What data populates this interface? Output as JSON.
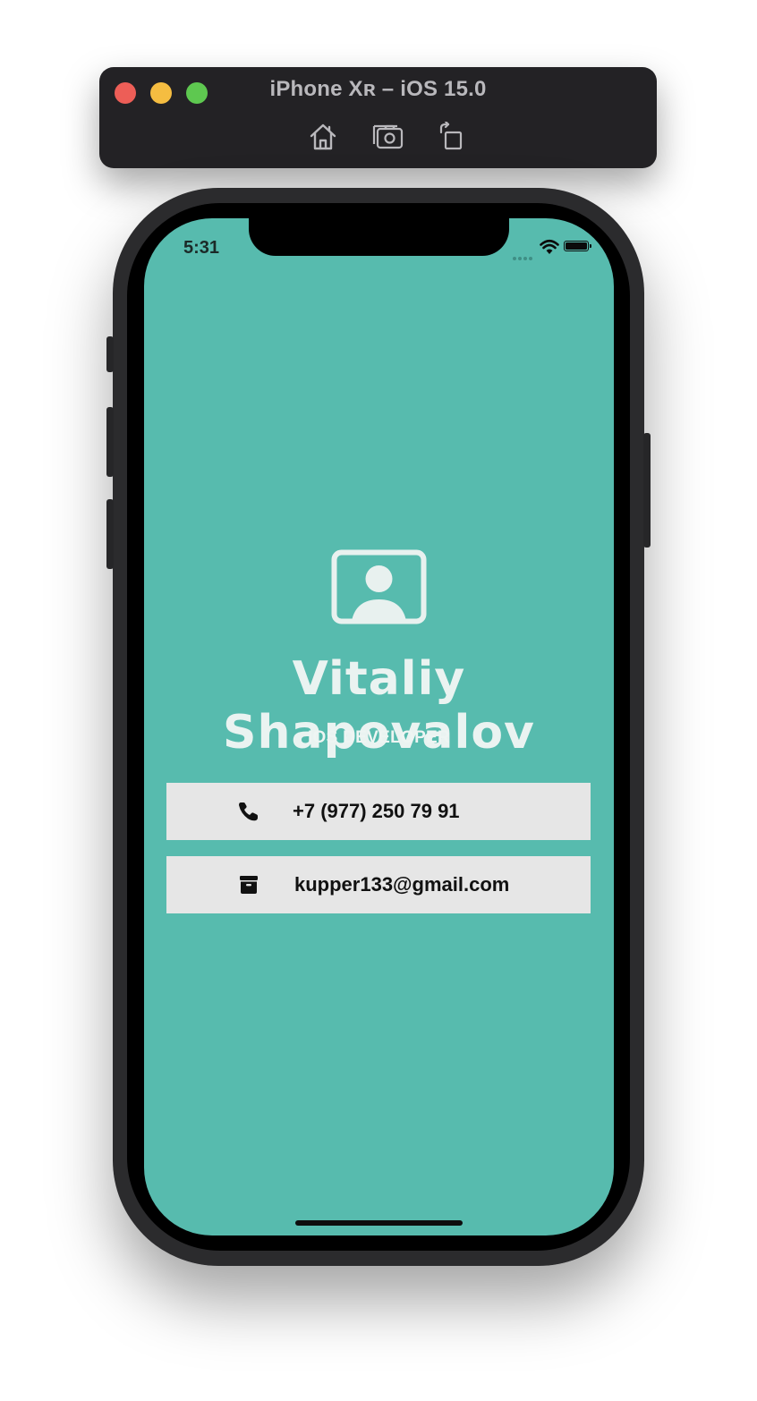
{
  "simulator": {
    "title": "iPhone Xʀ – iOS 15.0",
    "tools": [
      "home-icon",
      "screenshot-icon",
      "rotate-icon"
    ],
    "traffic_lights": [
      "#ed5e57",
      "#f5bd41",
      "#5ec850"
    ]
  },
  "status_bar": {
    "time": "5:31",
    "icons": [
      "signal-dots-icon",
      "wifi-icon",
      "battery-icon"
    ]
  },
  "profile": {
    "avatar_icon": "person-crop-rectangle-icon",
    "name": "Vitaliy Shapovalov",
    "title": "IOS DEVELOPER"
  },
  "contacts": [
    {
      "icon": "phone-icon",
      "value": "+7 (977) 250 79 91"
    },
    {
      "icon": "archive-box-icon",
      "value": "kupper133@gmail.com"
    }
  ],
  "colors": {
    "background": "#57bbae",
    "card": "#e6e6e6",
    "name_text": "#eaf3f1"
  }
}
